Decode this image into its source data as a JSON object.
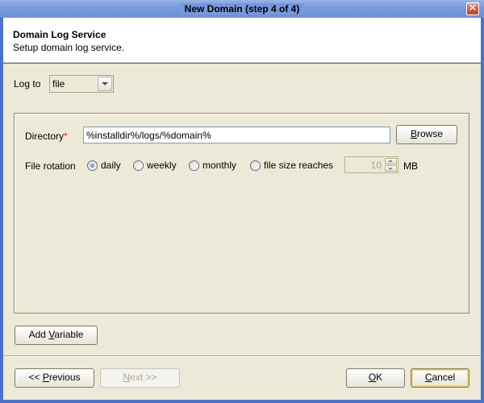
{
  "window": {
    "title": "New Domain (step 4 of 4)",
    "close_glyph": "✕"
  },
  "header": {
    "title": "Domain Log Service",
    "subtitle": "Setup domain log service."
  },
  "log_to": {
    "label": "Log to",
    "selected": "file"
  },
  "directory": {
    "label": "Directory",
    "required_marker": "*",
    "value": "%installdir%/logs/%domain%",
    "browse_label": "rowse",
    "browse_mnemonic": "B"
  },
  "file_rotation": {
    "label": "File rotation",
    "options": [
      {
        "label": "daily",
        "checked": true
      },
      {
        "label": "weekly",
        "checked": false
      },
      {
        "label": "monthly",
        "checked": false
      },
      {
        "label": "file size reaches",
        "checked": false
      }
    ],
    "size_value": "10",
    "size_unit": "MB"
  },
  "buttons": {
    "add_variable_pre": "Add ",
    "add_variable_mnemonic": "V",
    "add_variable_post": "ariable",
    "previous_pre": "<< ",
    "previous_mnemonic": "P",
    "previous_post": "revious",
    "next_mnemonic": "N",
    "next_post": "ext >>",
    "ok_mnemonic": "O",
    "ok_post": "K",
    "cancel_mnemonic": "C",
    "cancel_post": "ancel"
  }
}
